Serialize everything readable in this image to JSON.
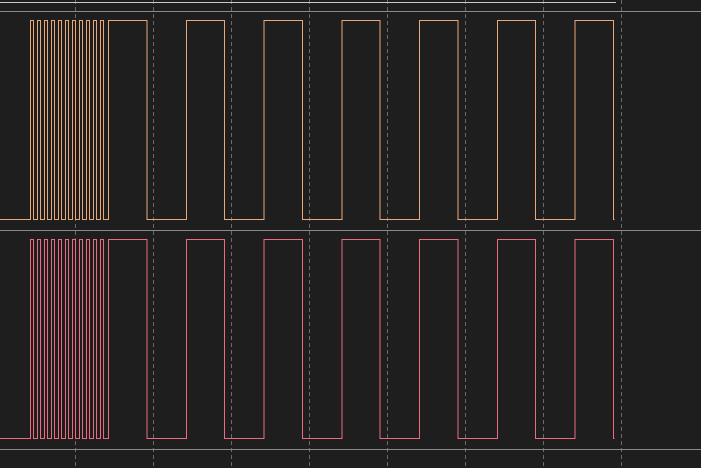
{
  "viewer": {
    "background": "#1e1e1e",
    "grid_color": "#6a6a6a",
    "separator_color": "#8a8a8a",
    "cursor_color": "#c8c8c8",
    "grid_style": "dashed-vertical"
  },
  "channels": [
    {
      "name": "",
      "color": "#e8a87a",
      "initial_level": 0,
      "burst": {
        "pulse_count": 11,
        "pattern": "fast"
      },
      "clock": {
        "cycles": 7,
        "duty": 0.5,
        "pattern": "slow"
      },
      "final_level": 0
    },
    {
      "name": "",
      "color": "#ee6a7f",
      "initial_level": 0,
      "burst": {
        "pulse_count": 11,
        "pattern": "fast"
      },
      "clock": {
        "cycles": 7,
        "duty": 0.5,
        "pattern": "slow"
      },
      "final_level": 0
    }
  ]
}
